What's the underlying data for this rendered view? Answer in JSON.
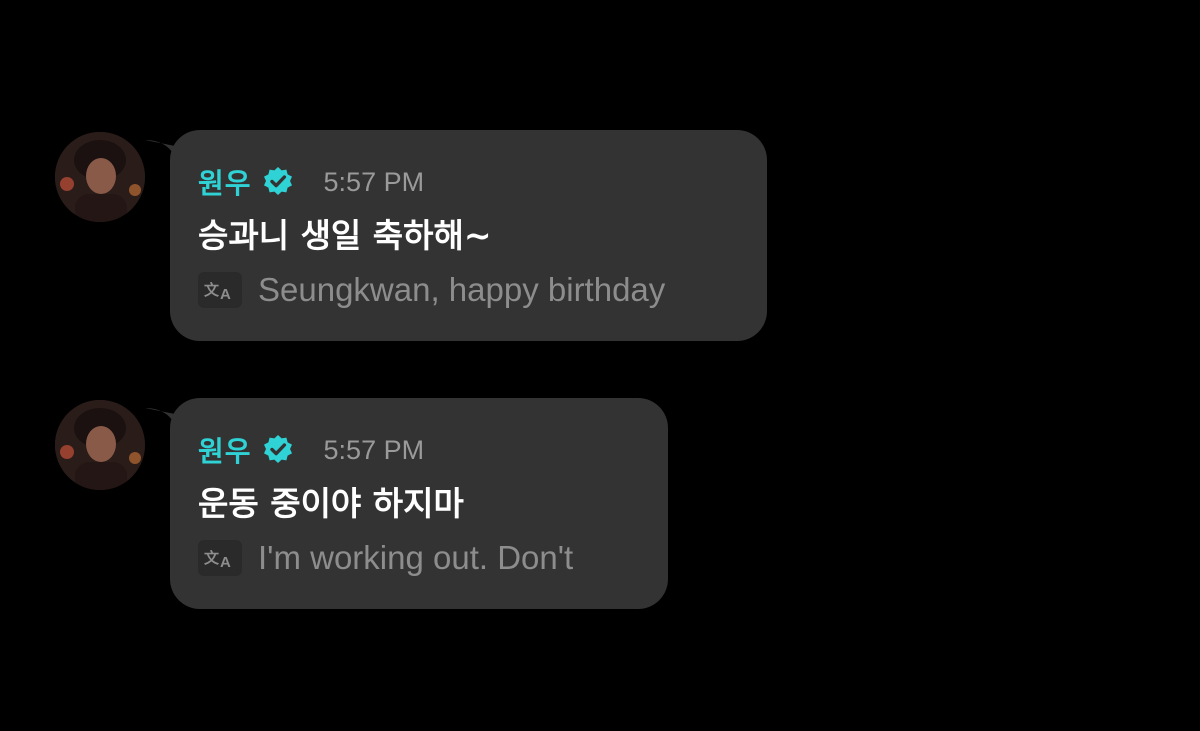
{
  "messages": [
    {
      "sender": "원우",
      "time": "5:57 PM",
      "text": "승과니 생일 축하해~",
      "translation": "Seungkwan, happy birthday"
    },
    {
      "sender": "원우",
      "time": "5:57 PM",
      "text": "운동 중이야 하지마",
      "translation": "I'm working out. Don't"
    }
  ],
  "icons": {
    "verified": "verified-badge-icon",
    "translate": "translate-icon"
  },
  "colors": {
    "background": "#000000",
    "bubble": "#333333",
    "sender_name": "#2fd3d6",
    "verified_badge": "#2fd3d6",
    "timestamp": "#9a9a9a",
    "message_text": "#ffffff",
    "translation_text": "#8d8d8d"
  }
}
